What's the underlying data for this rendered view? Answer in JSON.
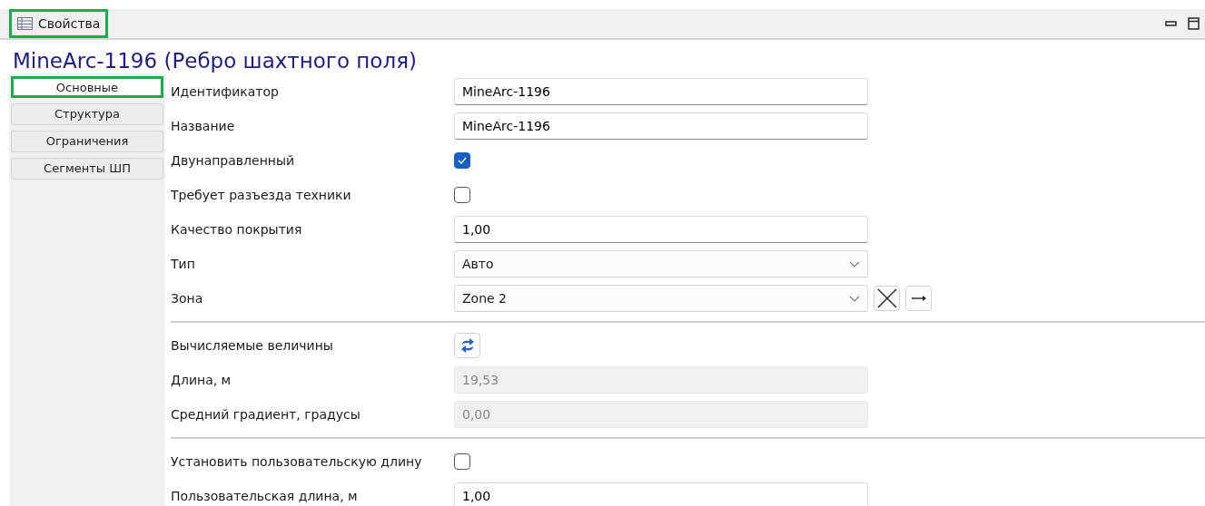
{
  "panel": {
    "title": "Свойства",
    "highlighted": true
  },
  "heading": "MineArc-1196 (Ребро шахтного поля)",
  "tabs": [
    {
      "label": "Основные",
      "selected": true
    },
    {
      "label": "Структура",
      "selected": false
    },
    {
      "label": "Ограничения",
      "selected": false
    },
    {
      "label": "Сегменты ШП",
      "selected": false
    }
  ],
  "rows": [
    {
      "kind": "text",
      "label": "Идентификатор",
      "value": "MineArc-1196"
    },
    {
      "kind": "text",
      "label": "Название",
      "value": "MineArc-1196"
    },
    {
      "kind": "checkbox",
      "label": "Двунаправленный",
      "checked": true
    },
    {
      "kind": "checkbox",
      "label": "Требует разъезда техники",
      "checked": false
    },
    {
      "kind": "text",
      "label": "Качество покрытия",
      "value": "1,00"
    },
    {
      "kind": "select",
      "label": "Тип",
      "value": "Авто"
    },
    {
      "kind": "select",
      "label": "Зона",
      "value": "Zone 2",
      "actions": true
    },
    {
      "kind": "separator"
    },
    {
      "kind": "refresh",
      "label": "Вычисляемые величины"
    },
    {
      "kind": "readonly",
      "label": "Длина, м",
      "value": "19,53"
    },
    {
      "kind": "readonly",
      "label": "Средний градиент, градусы",
      "value": "0,00"
    },
    {
      "kind": "separator"
    },
    {
      "kind": "checkbox",
      "label": "Установить пользовательскую длину",
      "checked": false
    },
    {
      "kind": "text",
      "label": "Пользовательская длина, м",
      "value": "1,00"
    }
  ]
}
